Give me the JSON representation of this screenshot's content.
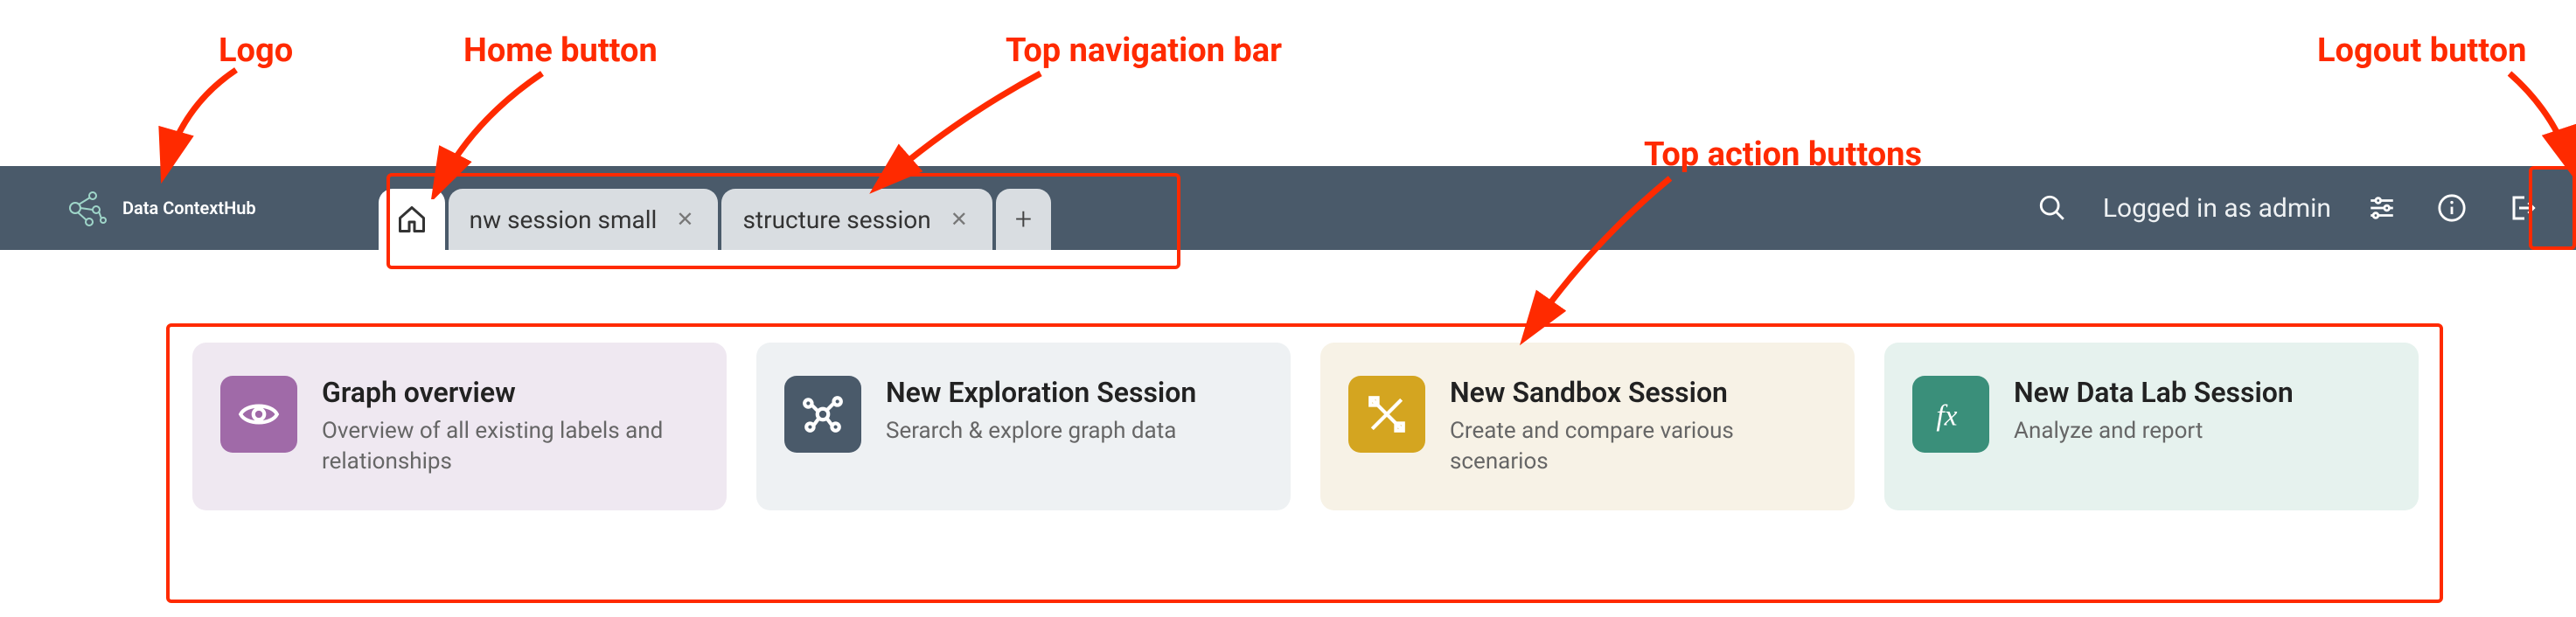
{
  "annotations": {
    "logo": "Logo",
    "home_button": "Home button",
    "top_nav": "Top navigation bar",
    "top_actions": "Top action buttons",
    "logout_button": "Logout button"
  },
  "brand": {
    "name": "Data ContextHub"
  },
  "tabs": [
    {
      "label": "nw session small"
    },
    {
      "label": "structure session"
    }
  ],
  "topbar": {
    "logged_in_text": "Logged in as admin"
  },
  "cards": {
    "graph_overview": {
      "title": "Graph overview",
      "subtitle": "Overview of all existing labels and relationships"
    },
    "exploration": {
      "title": "New Exploration Session",
      "subtitle": "Serarch & explore graph data"
    },
    "sandbox": {
      "title": "New Sandbox Session",
      "subtitle": "Create and compare various scenarios"
    },
    "datalab": {
      "title": "New Data Lab Session",
      "subtitle": "Analyze and report"
    }
  }
}
